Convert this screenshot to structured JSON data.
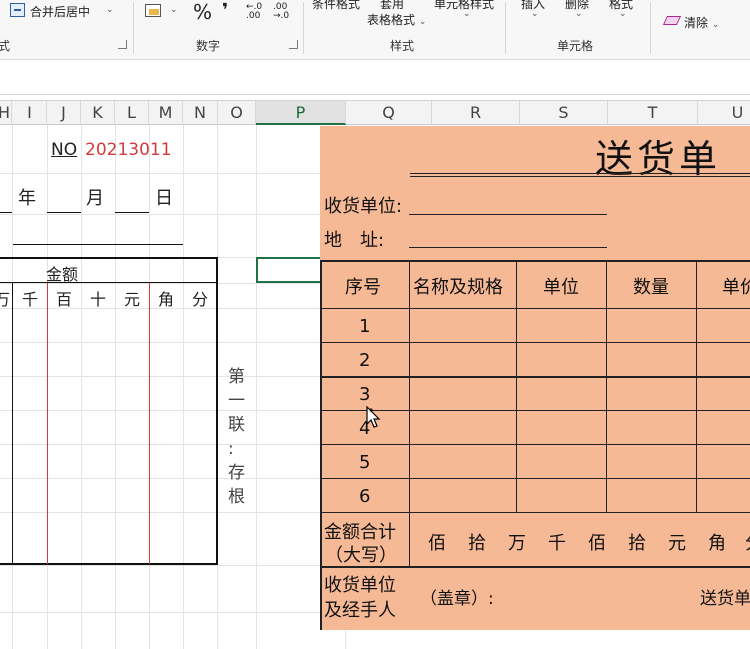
{
  "ribbon": {
    "merge_center": "合并后居中",
    "number_group": "数字",
    "percent_symbol": "%",
    "comma_symbol": "❜",
    "inc_decimal": "←.0 .00",
    "dec_decimal": ".00 →.0",
    "conditional_format": "条件格式",
    "apply_table_line1": "套用",
    "apply_table_line2": "表格格式",
    "cell_style": "单元格样式",
    "styles_group": "样式",
    "insert": "插入",
    "delete": "删除",
    "format": "格式",
    "cells_group": "单元格",
    "clear": "清除",
    "alignment_group_fragment": "式"
  },
  "columns": [
    "H",
    "I",
    "J",
    "K",
    "L",
    "M",
    "N",
    "O",
    "P",
    "Q",
    "R",
    "S",
    "T",
    "U"
  ],
  "selected_column": "P",
  "stub": {
    "no_label": "NO",
    "no_value": "20213011",
    "year": "年",
    "month": "月",
    "day": "日",
    "amount_header": "金额",
    "digit_units": [
      "万",
      "千",
      "百",
      "十",
      "元",
      "角",
      "分"
    ],
    "side_note": [
      "第",
      "一",
      "联",
      ":",
      "存",
      "根"
    ]
  },
  "note": {
    "title": "送货单",
    "receiver_label": "收货单位:",
    "address_label": "地　址:",
    "table_headers": [
      "序号",
      "名称及规格",
      "单位",
      "数量",
      "单价"
    ],
    "row_numbers": [
      "1",
      "2",
      "3",
      "4",
      "5",
      "6"
    ],
    "total_label_line1": "金额合计",
    "total_label_line2": "（大写）",
    "total_units": [
      "佰",
      "拾",
      "万",
      "千",
      "佰",
      "拾",
      "元",
      "角",
      "分"
    ],
    "footer_label_line1": "收货单位",
    "footer_label_line2": "及经手人",
    "stamp_label": "（盖章）:",
    "deliver_label": "送货单位"
  },
  "colors": {
    "note_fill": "#f6b996",
    "selection": "#217346",
    "no_value_color": "#d13b3b"
  }
}
